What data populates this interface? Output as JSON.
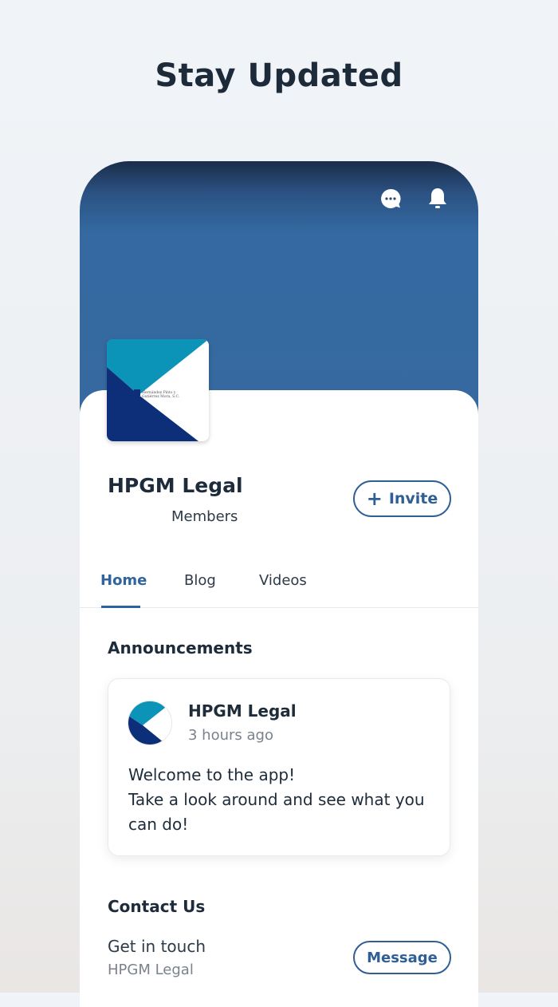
{
  "headline": "Stay Updated",
  "header": {
    "chat_icon": "chat-bubble-dots-icon",
    "bell_icon": "bell-icon"
  },
  "group": {
    "logo_text": "Hernández Pinto y Gutiérrez Mora, S.C.",
    "name": "HPGM Legal",
    "members_label": "Members",
    "invite_label": "Invite"
  },
  "tabs": [
    {
      "label": "Home"
    },
    {
      "label": "Blog"
    },
    {
      "label": "Videos"
    }
  ],
  "announcements": {
    "title": "Announcements",
    "post": {
      "author": "HPGM Legal",
      "time": "3 hours ago",
      "body_line1": "Welcome to the app!",
      "body_line2": "Take a look around and see what you can do!"
    }
  },
  "contact": {
    "title": "Contact Us",
    "line1": "Get in touch",
    "line2": "HPGM Legal",
    "message_label": "Message"
  },
  "colors": {
    "accent": "#2f64a0",
    "cover": "#3669a0"
  }
}
